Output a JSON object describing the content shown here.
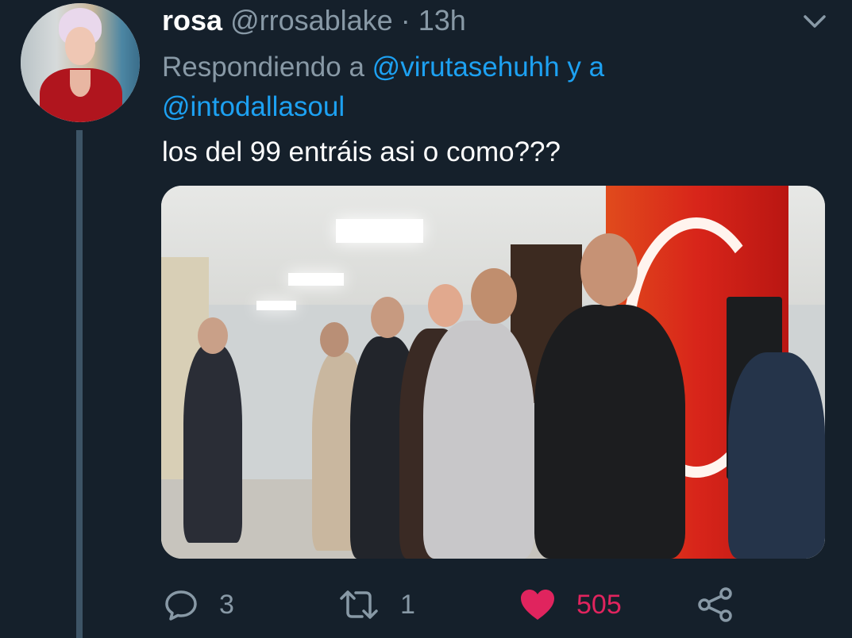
{
  "tweet": {
    "display_name": "rosa",
    "handle": "@rrosablake",
    "separator": "·",
    "time": "13h",
    "replying_prefix": "Respondiendo a",
    "mention_1": "@virutasehuhh",
    "replying_conjunction": "y a",
    "mention_2": "@intodallasoul",
    "text": "los del 99 entráis asi o como???"
  },
  "actions": {
    "reply": {
      "icon": "reply-icon",
      "count": "3"
    },
    "retweet": {
      "icon": "retweet-icon",
      "count": "1"
    },
    "like": {
      "icon": "heart-icon",
      "count": "505",
      "liked": true
    },
    "share": {
      "icon": "share-icon"
    }
  },
  "colors": {
    "background": "#15202b",
    "text": "#ffffff",
    "muted": "#8899a6",
    "link": "#1da1f2",
    "like": "#e0245e"
  }
}
